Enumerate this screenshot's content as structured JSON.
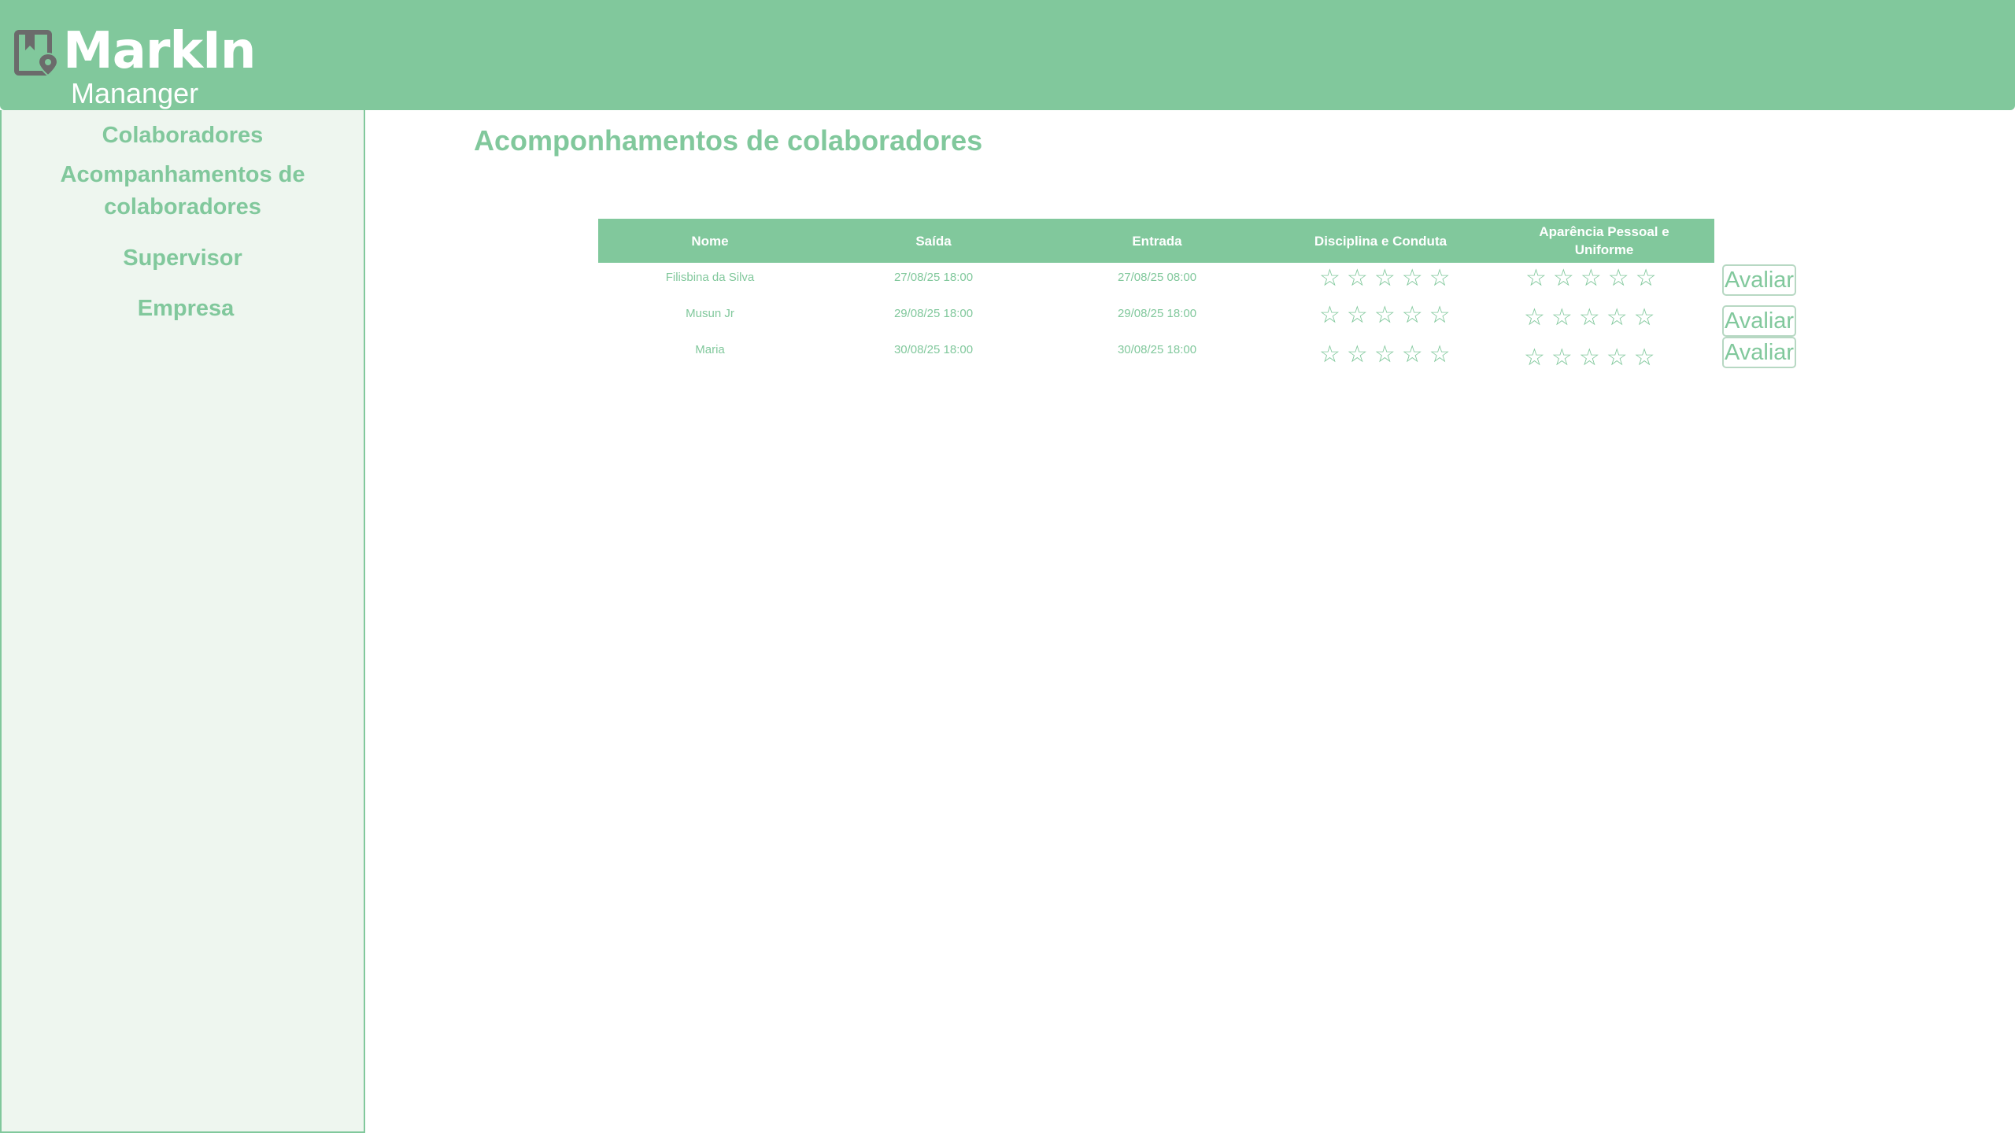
{
  "app": {
    "logo_title": "MarkIn",
    "logo_subtitle": "Mananger"
  },
  "colors": {
    "accent": "#81c89c",
    "sidebar_bg": "#eef6ef",
    "button_border": "#b7d8c3"
  },
  "sidebar": {
    "items": [
      {
        "label": "Colaboradores"
      },
      {
        "label": "Acompanhamentos de colaboradores"
      },
      {
        "label": "Supervisor"
      },
      {
        "label": "Empresa"
      }
    ]
  },
  "main": {
    "title": "Acomponhamentos de colaboradores",
    "table": {
      "headers": [
        "Nome",
        "Saída",
        "Entrada",
        "Disciplina e Conduta",
        "Aparência Pessoal e Uniforme"
      ],
      "rows": [
        {
          "nome": "Filisbina da Silva",
          "saida": "27/08/25 18:00",
          "entrada": "27/08/25 08:00",
          "disciplina_rating": 0,
          "aparencia_rating": 0,
          "action": "Avaliar"
        },
        {
          "nome": "Musun Jr",
          "saida": "29/08/25 18:00",
          "entrada": "29/08/25 18:00",
          "disciplina_rating": 0,
          "aparencia_rating": 0,
          "action": "Avaliar"
        },
        {
          "nome": "Maria",
          "saida": "30/08/25 18:00",
          "entrada": "30/08/25 18:00",
          "disciplina_rating": 0,
          "aparencia_rating": 0,
          "action": "Avaliar"
        }
      ],
      "star_glyph": "☆",
      "max_stars": 5
    }
  }
}
